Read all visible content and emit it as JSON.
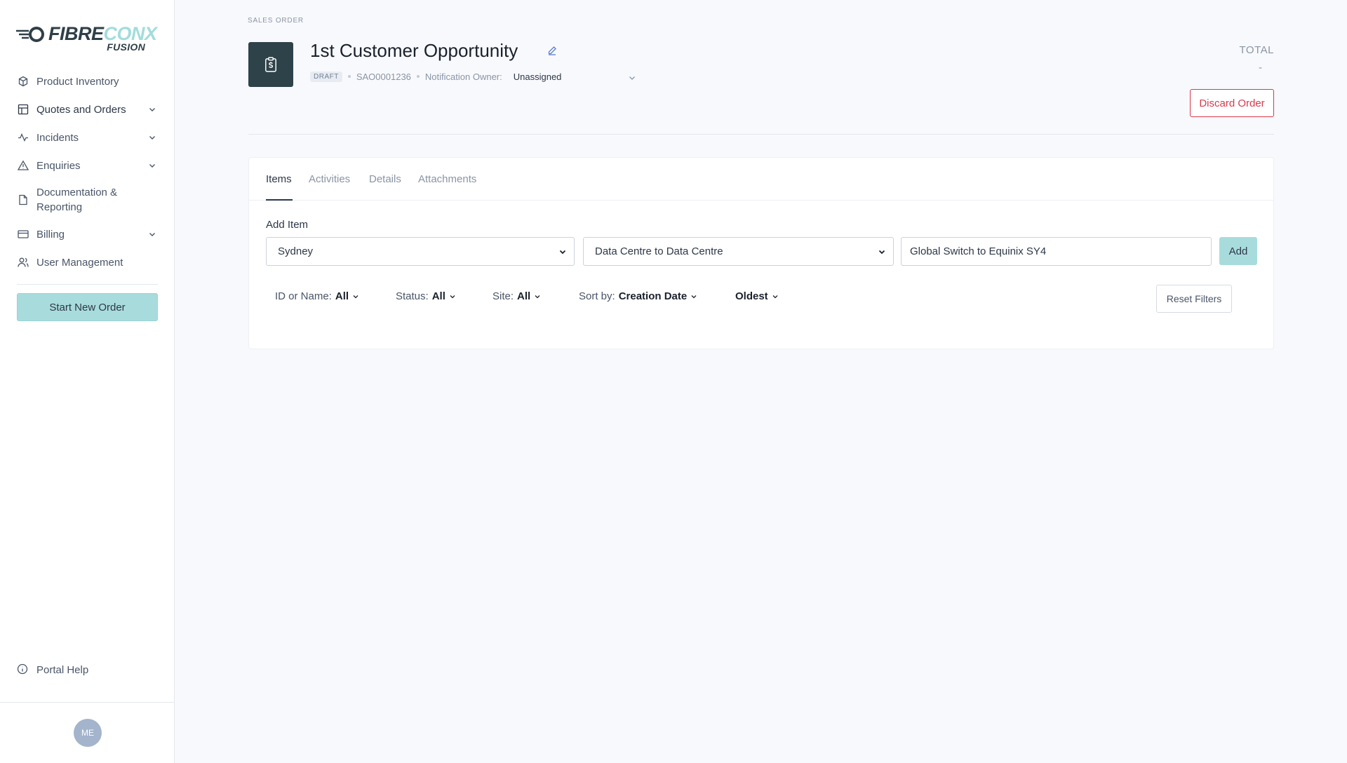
{
  "brand": {
    "word_part1": "FIBRE",
    "word_part2": "CONX",
    "sub": "FUSION",
    "accent_color": "#a8dcdc",
    "dark_color": "#2e4249"
  },
  "sidebar": {
    "items": [
      {
        "label": "Product Inventory",
        "icon": "cube-icon",
        "has_chevron": false
      },
      {
        "label": "Quotes and Orders",
        "icon": "layout-icon",
        "has_chevron": true
      },
      {
        "label": "Incidents",
        "icon": "activity-icon",
        "has_chevron": true
      },
      {
        "label": "Enquiries",
        "icon": "alert-triangle-icon",
        "has_chevron": true
      },
      {
        "label": "Documentation & Reporting",
        "icon": "document-icon",
        "has_chevron": false
      },
      {
        "label": "Billing",
        "icon": "credit-card-icon",
        "has_chevron": true
      },
      {
        "label": "User Management",
        "icon": "users-icon",
        "has_chevron": false
      }
    ],
    "start_order_label": "Start New Order",
    "help_label": "Portal Help",
    "avatar_initials": "ME"
  },
  "header": {
    "eyebrow": "SALES ORDER",
    "title": "1st Customer Opportunity",
    "status_badge": "DRAFT",
    "order_id": "SAO0001236",
    "owner_label": "Notification Owner:",
    "owner_value": "Unassigned",
    "total_label": "TOTAL",
    "total_value": "-",
    "discard_label": "Discard Order",
    "discard_color": "#d83a4c"
  },
  "tabs": [
    {
      "label": "Items",
      "active": true
    },
    {
      "label": "Activities",
      "active": false
    },
    {
      "label": "Details",
      "active": false
    },
    {
      "label": "Attachments",
      "active": false
    }
  ],
  "add_item": {
    "label": "Add Item",
    "region_value": "Sydney",
    "type_value": "Data Centre to Data Centre",
    "route_value": "Global Switch to Equinix SY4",
    "add_label": "Add"
  },
  "filters": {
    "id_label": "ID or Name:",
    "id_value": "All",
    "status_label": "Status:",
    "status_value": "All",
    "site_label": "Site:",
    "site_value": "All",
    "sort_label": "Sort by:",
    "sort_value": "Creation Date",
    "order_value": "Oldest",
    "reset_label": "Reset Filters"
  }
}
